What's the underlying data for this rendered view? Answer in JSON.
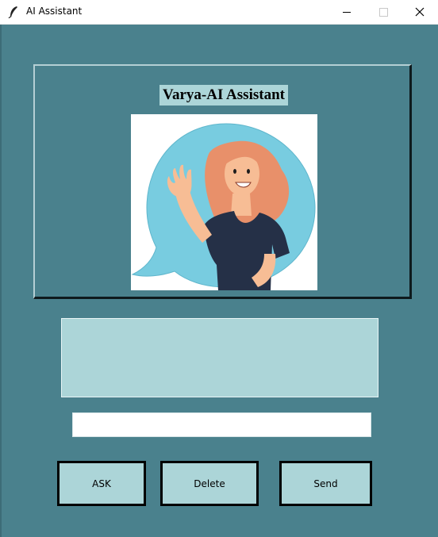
{
  "window": {
    "title": "AI Assistant",
    "controls": [
      "minimize-icon",
      "maximize-icon",
      "close-icon"
    ]
  },
  "header": {
    "heading": "Varya-AI Assistant",
    "avatar_icon": "waving-woman-chat-bubble-illustration"
  },
  "output": {
    "text": ""
  },
  "question_input": {
    "value": "",
    "placeholder": ""
  },
  "buttons": {
    "ask": "ASK",
    "delete": "Delete",
    "send": "Send"
  },
  "colors": {
    "background": "#4a818d",
    "panel_light": "#acd5d8",
    "bubble": "#78cce0",
    "hair": "#e8906a",
    "shirt": "#253047",
    "skin": "#f7bd95"
  }
}
